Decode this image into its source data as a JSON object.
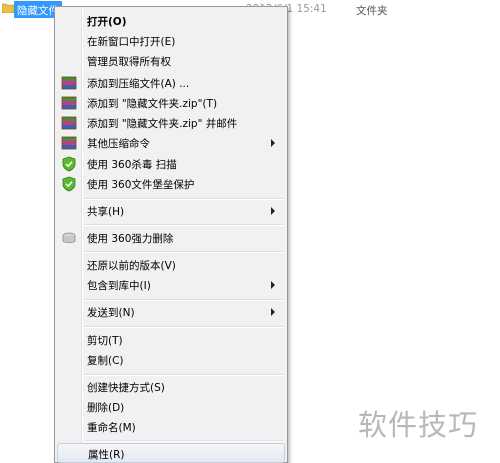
{
  "file_row": {
    "name": "隐藏文件夹",
    "date": "2012/6/1 15:41",
    "type": "文件夹"
  },
  "context_menu": {
    "items": [
      {
        "label": "打开(O)",
        "icon": "none"
      },
      {
        "label": "在新窗口中打开(E)",
        "icon": "none"
      },
      {
        "label": "管理员取得所有权",
        "icon": "none"
      },
      {
        "label": "添加到压缩文件(A) ...",
        "icon": "winrar-icon"
      },
      {
        "label": "添加到 \"隐藏文件夹.zip\"(T)",
        "icon": "winrar-icon"
      },
      {
        "label": "添加到 \"隐藏文件夹.zip\" 并邮件",
        "icon": "winrar-icon"
      },
      {
        "label": "其他压缩命令",
        "icon": "winrar-icon"
      },
      {
        "label": "使用 360杀毒 扫描",
        "icon": "360-shield-icon"
      },
      {
        "label": "使用 360文件堡垒保护",
        "icon": "360-shield-icon"
      },
      {
        "label": "共享(H)",
        "icon": "none"
      },
      {
        "label": "使用 360强力删除",
        "icon": "360-delete-icon"
      },
      {
        "label": "还原以前的版本(V)",
        "icon": "none"
      },
      {
        "label": "包含到库中(I)",
        "icon": "none"
      },
      {
        "label": "发送到(N)",
        "icon": "none"
      },
      {
        "label": "剪切(T)",
        "icon": "none"
      },
      {
        "label": "复制(C)",
        "icon": "none"
      },
      {
        "label": "创建快捷方式(S)",
        "icon": "none"
      },
      {
        "label": "删除(D)",
        "icon": "none"
      },
      {
        "label": "重命名(M)",
        "icon": "none"
      },
      {
        "label": "属性(R)",
        "icon": "none"
      }
    ]
  },
  "watermark": "软件技巧",
  "colors": {
    "selection": "#3399ff",
    "menu_bg": "#f1f1f1"
  }
}
